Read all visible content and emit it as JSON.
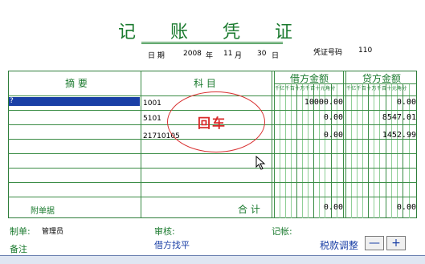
{
  "header": {
    "title": "记 账 凭 证",
    "date_label_ri": "日 期",
    "year": "2008",
    "year_unit": "年",
    "month": "11",
    "month_unit": "月",
    "day": "30",
    "day_unit": "日",
    "voucher_no_label": "凭证号码",
    "voucher_no": "110"
  },
  "table": {
    "col_summary": "摘        要",
    "col_account": "科        目",
    "col_debit": "借方金额",
    "col_credit": "贷方金额",
    "digit_headers": "千亿千百十万千百十元角分",
    "rows": [
      {
        "summary": "?",
        "account": "1001",
        "debit": "10000.00",
        "credit": "0.00"
      },
      {
        "summary": "",
        "account": "5101",
        "debit": "0.00",
        "credit": "8547.01"
      },
      {
        "summary": "",
        "account": "21710105",
        "debit": "0.00",
        "credit": "1452.99"
      }
    ],
    "attach_label": "附单据",
    "total_label": "合  计",
    "total_debit": "0.00",
    "total_credit": "0.00"
  },
  "footer": {
    "maker_label": "制单:",
    "maker_name": "管理员",
    "review_label": "审核:",
    "bookkeep_label": "记帐:",
    "remark_label": "备注",
    "balance_button": "借方找平",
    "tax_adjust_label": "税款调整",
    "minus": "—",
    "plus": "+"
  },
  "annotation": {
    "text": "回车"
  },
  "colors": {
    "grid_green": "#3a8c45",
    "title_green": "#1a7a2e",
    "label_blue": "#1a3fa6",
    "annotation_red": "#d82a2a"
  }
}
